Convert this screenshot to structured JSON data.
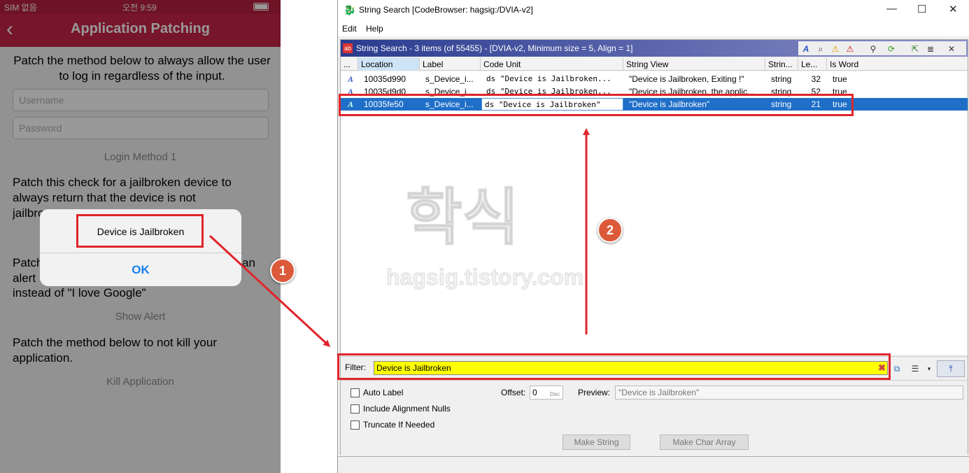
{
  "phone": {
    "status": {
      "carrier": "SIM 없음",
      "time": "오전 9:59"
    },
    "nav": {
      "back": "‹",
      "title": "Application Patching"
    },
    "intro": "Patch the method below to always allow the user to log in regardless of the input.",
    "username_placeholder": "Username",
    "password_placeholder": "Password",
    "login_button": "Login Method 1",
    "jb_text_line1": "Patch this check for a jailbroken device to",
    "jb_text_line2": "always return that the device is not",
    "jb_text_line3": "jailbro",
    "alert_text_line1a": "Patch",
    "alert_text_line1b": "an",
    "alert_text_line2": "alert",
    "alert_text_line3": "instead of \"I love Google\"",
    "show_alert": "Show Alert",
    "kill_text": "Patch the method below to not kill your application.",
    "kill_button": "Kill Application",
    "alert": {
      "message": "Device is Jailbroken",
      "ok": "OK"
    }
  },
  "window": {
    "title": "String Search [CodeBrowser: hagsig:/DVIA-v2]",
    "controls": {
      "minimize": "—",
      "maximize": "☐",
      "close": "✕"
    },
    "menu": [
      "Edit",
      "Help"
    ],
    "panel_title": "String Search - 3 items (of 55455) - [DVIA-v2, Minimum size = 5, Align = 1]",
    "columns": [
      "...",
      "Location",
      "Label",
      "Code Unit",
      "String View",
      "Strin...",
      "Le...",
      "Is Word"
    ],
    "rows": [
      {
        "location": "10035d990",
        "label": "s_Device_i...",
        "code_unit": "ds \"Device is Jailbroken...",
        "string_view": "\"Device is Jailbroken, Exiting !\"",
        "type": "string",
        "length": "32",
        "is_word": "true"
      },
      {
        "location": "10035d9d0",
        "label": "s_Device_i...",
        "code_unit": "ds \"Device is Jailbroken...",
        "string_view": "\"Device is Jailbroken, the applic...",
        "type": "string",
        "length": "52",
        "is_word": "true"
      },
      {
        "location": "10035fe50",
        "label": "s_Device_i...",
        "code_unit": "ds \"Device is Jailbroken\"",
        "string_view": "\"Device is Jailbroken\"",
        "type": "string",
        "length": "21",
        "is_word": "true"
      }
    ],
    "filter_label": "Filter:",
    "filter_value": "Device is Jailbroken",
    "options": {
      "auto_label": "Auto Label",
      "include_nulls": "Include Alignment Nulls",
      "truncate": "Truncate If Needed",
      "offset_label": "Offset:",
      "offset_value": "0",
      "offset_unit": "Dec",
      "preview_label": "Preview:",
      "preview_value": "\"Device is Jailbroken\"",
      "make_string": "Make String",
      "make_char_array": "Make Char Array"
    }
  },
  "annotations": {
    "badge1": "1",
    "badge2": "2",
    "watermark_kr": "학식",
    "watermark_url": "hagsig.tistory.com"
  },
  "colors": {
    "phone_nav": "#c72346",
    "selection": "#1f6fc9",
    "annotation_red": "#e0252b",
    "badge": "#dc5a3a",
    "filter_bg": "#ffff00"
  }
}
